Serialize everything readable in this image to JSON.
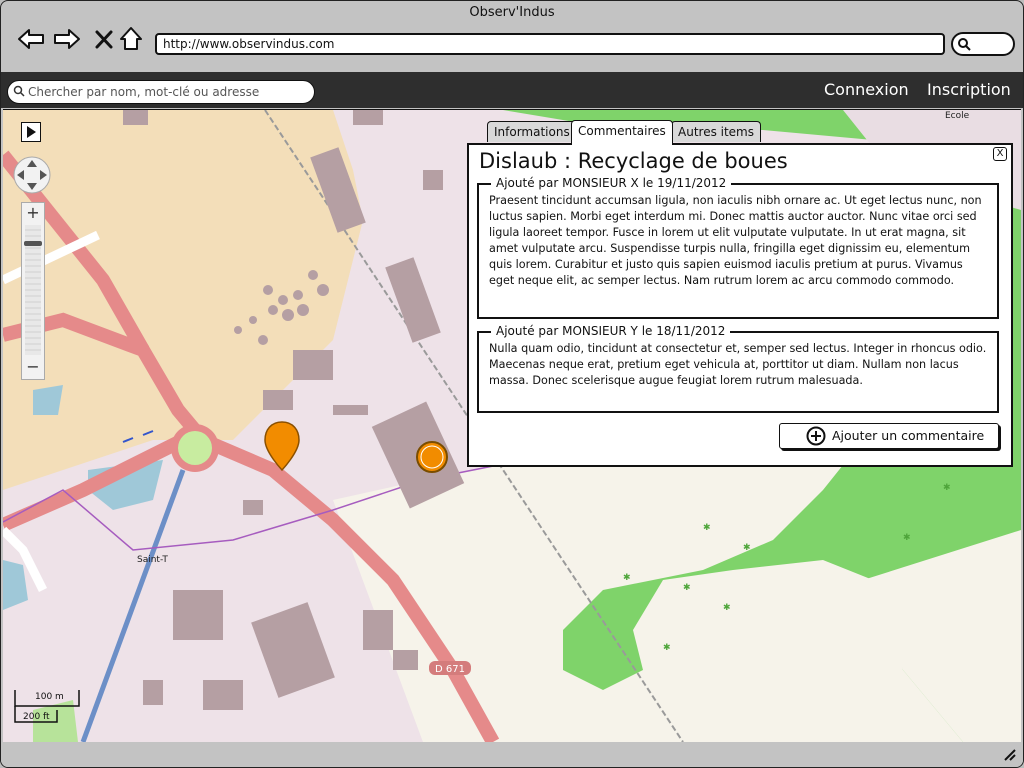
{
  "browser": {
    "title": "Observ'Indus",
    "url": "http://www.observindus.com",
    "back_icon": "arrow-left-icon",
    "forward_icon": "arrow-right-icon",
    "stop_icon": "close-icon",
    "home_icon": "home-icon"
  },
  "app": {
    "search_placeholder": "Chercher par nom, mot-clé ou adresse",
    "login": "Connexion",
    "signup": "Inscription"
  },
  "map": {
    "labels": {
      "road": "D 671",
      "place": "Saint-T",
      "poi": "Ecole"
    },
    "scale": {
      "metric": "100 m",
      "imperial": "200 ft"
    }
  },
  "popup": {
    "tabs": [
      "Informations",
      "Commentaires",
      "Autres items"
    ],
    "active_tab": "Commentaires",
    "title": "Dislaub : Recyclage de boues",
    "close": "X",
    "comments": [
      {
        "header": "Ajouté par MONSIEUR X le 19/11/2012",
        "text": "Praesent tincidunt accumsan ligula, non iaculis nibh ornare ac. Ut eget lectus nunc, non luctus sapien. Morbi eget interdum mi. Donec mattis auctor auctor. Nunc vitae orci sed ligula laoreet tempor. Fusce in lorem ut elit vulputate vulputate. In ut erat magna, sit amet vulputate arcu. Suspendisse turpis nulla, fringilla eget dignissim eu, elementum quis lorem. Curabitur et justo quis sapien euismod iaculis pretium at purus. Vivamus eget neque elit, ac semper lectus. Nam rutrum lorem ac arcu commodo commodo."
      },
      {
        "header": "Ajouté par MONSIEUR Y le 18/11/2012",
        "text": "Nulla quam odio, tincidunt at consectetur et, semper sed lectus. Integer in rhoncus odio. Maecenas neque erat, pretium eget vehicula at, porttitor ut diam. Nullam non lacus massa. Donec scelerisque augue feugiat lorem rutrum malesuada."
      }
    ],
    "add_button": "Ajouter un commentaire"
  },
  "colors": {
    "marker": "#f28c00",
    "road": "#e58a8a",
    "park": "#6fcf5b",
    "water": "#9fc8d8"
  }
}
